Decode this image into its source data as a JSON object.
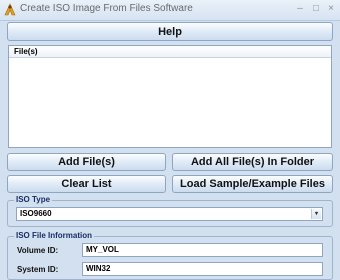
{
  "window": {
    "title": "Create ISO Image From Files Software",
    "minimize": "–",
    "maximize": "□",
    "close": "×"
  },
  "toolbar": {
    "help_label": "Help"
  },
  "file_list": {
    "header": "File(s)"
  },
  "buttons": {
    "add_files": "Add File(s)",
    "add_all_files_in_folder": "Add All File(s) In Folder",
    "clear_list": "Clear List",
    "load_sample": "Load Sample/Example Files"
  },
  "iso_type": {
    "legend": "ISO Type",
    "selected": "ISO9660"
  },
  "iso_info": {
    "legend": "ISO File Information",
    "volume_id_label": "Volume ID:",
    "volume_id_value": "MY_VOL",
    "system_id_label": "System ID:",
    "system_id_value": "WIN32"
  },
  "colors": {
    "window_bg": "#d2e0f0",
    "button_border": "#8fa6c2",
    "legend_text": "#1a2e66"
  },
  "icons": [
    "app-icon",
    "minimize-icon",
    "maximize-icon",
    "close-icon",
    "dropdown-arrow-icon"
  ]
}
